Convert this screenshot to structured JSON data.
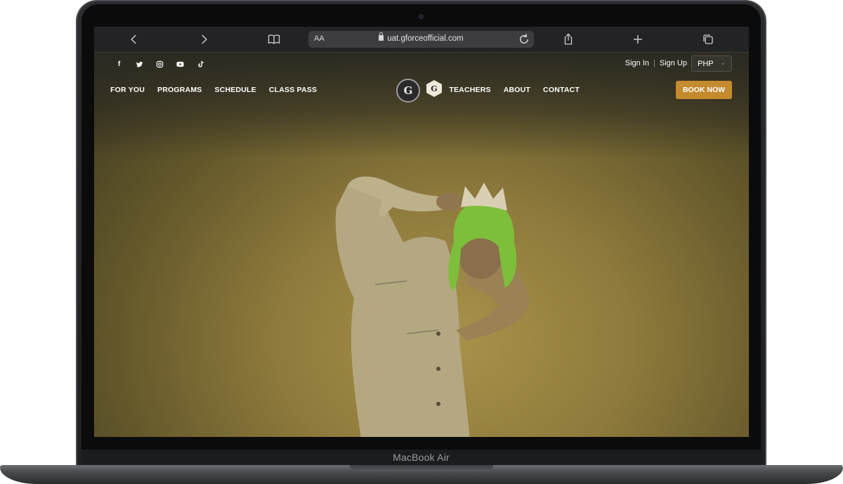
{
  "device": {
    "label": "MacBook Air"
  },
  "browser": {
    "reader_label": "AA",
    "url": "uat.gforceofficial.com"
  },
  "site": {
    "social_icons": [
      "facebook-icon",
      "twitter-icon",
      "instagram-icon",
      "youtube-icon",
      "tiktok-icon"
    ],
    "auth": {
      "sign_in": "Sign In",
      "separator": "|",
      "sign_up": "Sign Up"
    },
    "currency": {
      "selected": "PHP"
    },
    "nav_left": [
      "FOR YOU",
      "PROGRAMS",
      "SCHEDULE",
      "CLASS PASS"
    ],
    "nav_right": [
      "TEACHERS",
      "ABOUT",
      "CONTACT"
    ],
    "cta": "BOOK NOW",
    "colors": {
      "accent": "#c48a2e",
      "hero": "#8e7a3c"
    }
  }
}
